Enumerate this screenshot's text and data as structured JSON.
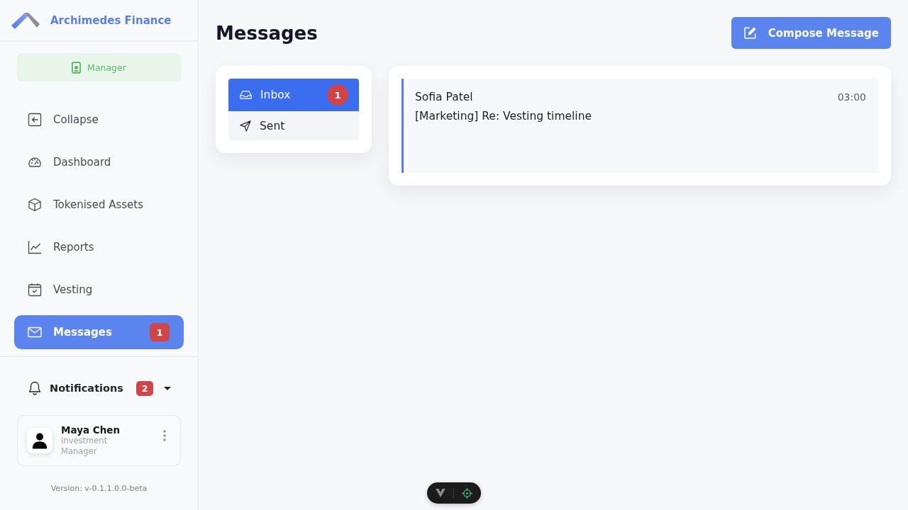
{
  "sidebar": {
    "brand": "Archimedes Finance",
    "role": "Manager",
    "nav_items": [
      {
        "label": "Collapse",
        "selected": false
      },
      {
        "label": "Dashboard",
        "selected": false
      },
      {
        "label": "Tokenised Assets",
        "selected": false
      },
      {
        "label": "Reports",
        "selected": false
      },
      {
        "label": "Vesting",
        "selected": false
      },
      {
        "label": "Messages",
        "selected": true,
        "badge": "1"
      }
    ],
    "notifications": {
      "label": "Notifications",
      "badge": "2"
    },
    "user": {
      "name": "Maya Chen",
      "role": "Investment Manager"
    },
    "version": "Version: v-0.1.1.0.0-beta"
  },
  "main": {
    "title": "Messages",
    "compose_button": "Compose Message",
    "folders": [
      {
        "label": "Inbox",
        "selected": true,
        "badge": "1"
      },
      {
        "label": "Sent",
        "selected": false
      }
    ],
    "messages": [
      {
        "sender": "Sofia Patel",
        "subject": "[Marketing] Re: Vesting timeline",
        "time": "03:00",
        "unread": true
      }
    ]
  }
}
